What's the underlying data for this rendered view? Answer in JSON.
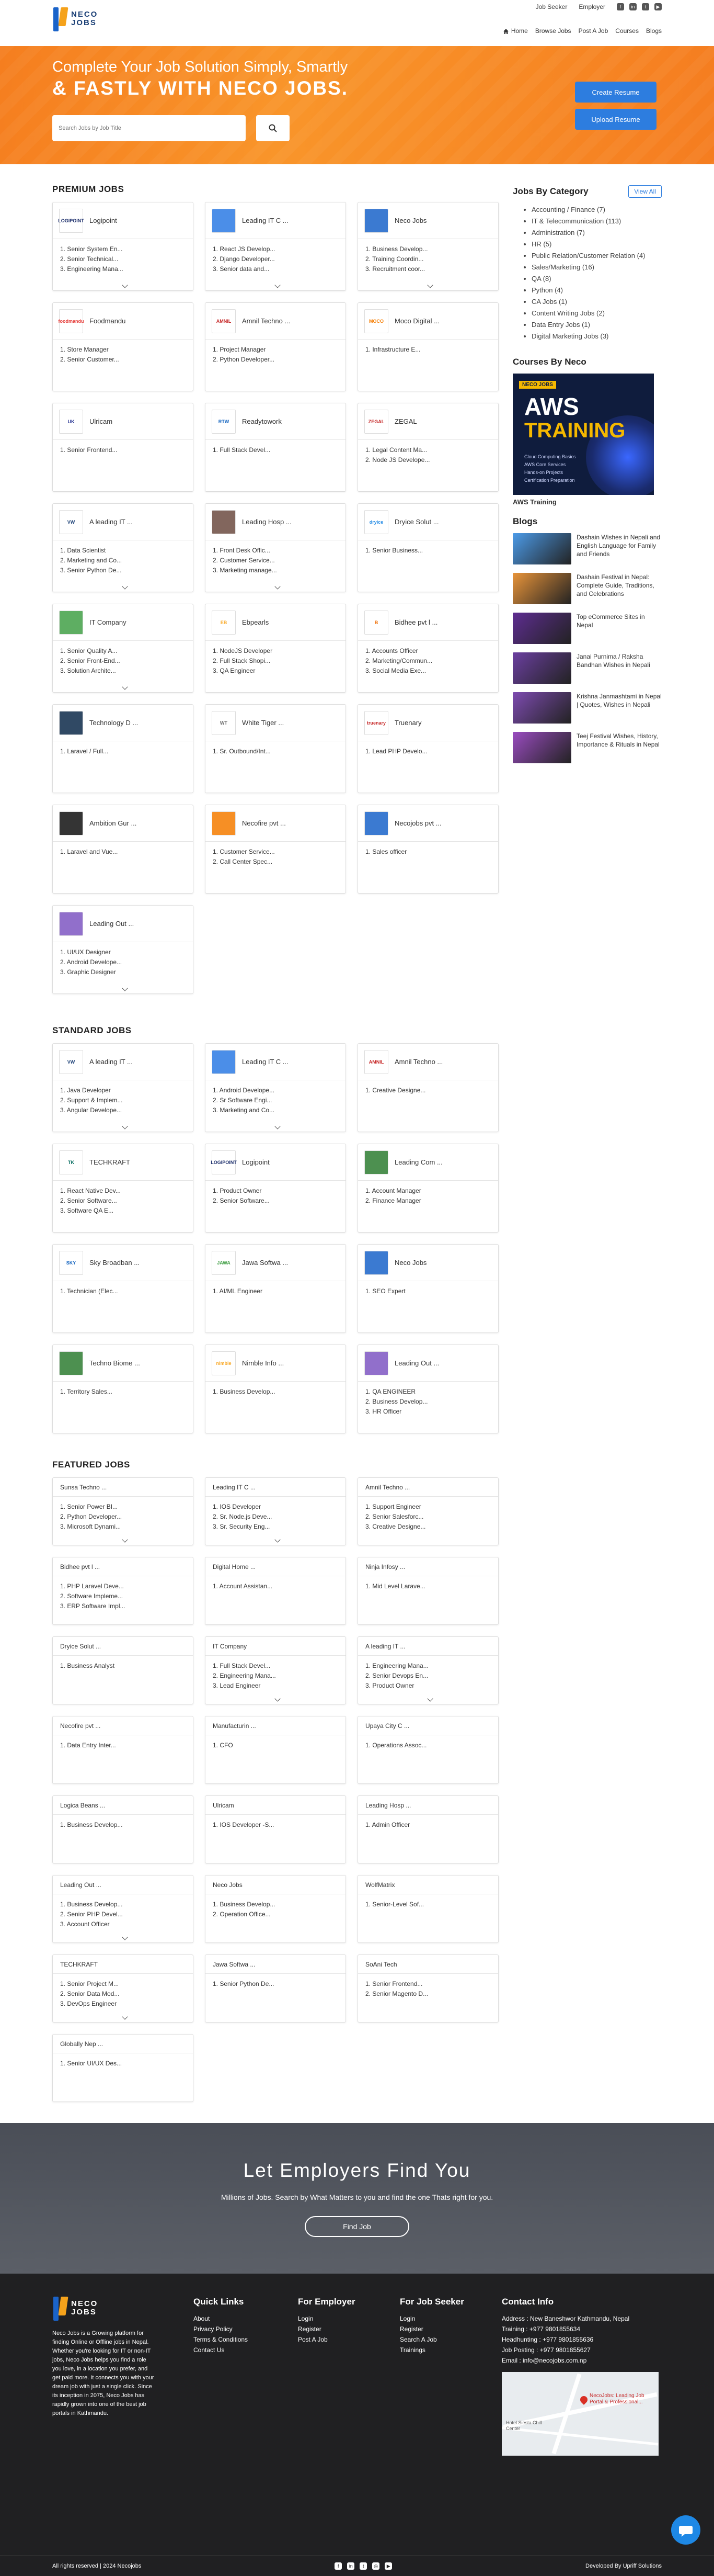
{
  "brand": {
    "logo_line1": "NECO",
    "logo_line2": "JOBS"
  },
  "topbar": {
    "job_seeker": "Job Seeker",
    "employer": "Employer"
  },
  "nav": [
    "Home",
    "Browse Jobs",
    "Post A Job",
    "Courses",
    "Blogs"
  ],
  "hero": {
    "line1": "Complete Your Job Solution Simply, Smartly",
    "line2": "& FASTLY WITH NECO JOBS.",
    "search_placeholder": "Search Jobs by Job Title",
    "create_resume": "Create Resume",
    "upload_resume": "Upload Resume"
  },
  "premium": {
    "title": "PREMIUM JOBS",
    "cards": [
      {
        "name": "Logipoint",
        "logo": "LOGIPOINT",
        "logo_color": "#1b2d6b",
        "jobs": [
          "1. Senior System En...",
          "2. Senior Technical...",
          "3. Engineering Mana..."
        ],
        "more": true
      },
      {
        "name": "Leading IT C ...",
        "logo": "",
        "logo_color": "#2c7be5",
        "jobs": [
          "1. React JS Develop...",
          "2. Django Developer...",
          "3. Senior data and..."
        ],
        "more": true
      },
      {
        "name": "Neco Jobs",
        "logo": "",
        "logo_color": "#1a63c9",
        "jobs": [
          "1. Business Develop...",
          "2. Training Coordin...",
          "3. Recruitment coor..."
        ],
        "more": true
      },
      {
        "name": "Foodmandu",
        "logo": "foodmandu",
        "logo_color": "#e53935",
        "jobs": [
          "1. Store Manager",
          "2. Senior Customer..."
        ],
        "more": false
      },
      {
        "name": "Amnil Techno ...",
        "logo": "AMNIL",
        "logo_color": "#c62828",
        "jobs": [
          "1. Project Manager",
          "2. Python Developer..."
        ],
        "more": false
      },
      {
        "name": "Moco Digital ...",
        "logo": "MOCO",
        "logo_color": "#f57c00",
        "jobs": [
          "1. Infrastructure E..."
        ],
        "more": false
      },
      {
        "name": "Ulricam",
        "logo": "UK",
        "logo_color": "#283593",
        "jobs": [
          "1. Senior Frontend..."
        ],
        "more": false
      },
      {
        "name": "Readytowork",
        "logo": "RTW",
        "logo_color": "#1565c0",
        "jobs": [
          "1. Full Stack Devel..."
        ],
        "more": false
      },
      {
        "name": "ZEGAL",
        "logo": "ZEGAL",
        "logo_color": "#c62828",
        "jobs": [
          "1. Legal Content Ma...",
          "2. Node JS Develope..."
        ],
        "more": false
      },
      {
        "name": "A leading IT ...",
        "logo": "VW",
        "logo_color": "#1a3f75",
        "jobs": [
          "1. Data Scientist",
          "2. Marketing and Co...",
          "3. Senior Python De..."
        ],
        "more": true
      },
      {
        "name": "Leading Hosp ...",
        "logo": "",
        "logo_color": "#6d4c41",
        "jobs": [
          "1. Front Desk Offic...",
          "2. Customer Service...",
          "3. Marketing manage..."
        ],
        "more": true
      },
      {
        "name": "Dryice Solut ...",
        "logo": "dryice",
        "logo_color": "#1e88e5",
        "jobs": [
          "1. Senior Business..."
        ],
        "more": false
      },
      {
        "name": "IT Company",
        "logo": "",
        "logo_color": "#43a047",
        "jobs": [
          "1. Senior Quality A...",
          "2. Senior Front-End...",
          "3. Solution Archite..."
        ],
        "more": true
      },
      {
        "name": "Ebpearls",
        "logo": "EB",
        "logo_color": "#f9a825",
        "jobs": [
          "1. NodeJS Developer",
          "2. Full Stack Shopi...",
          "3. QA Engineer"
        ],
        "more": false
      },
      {
        "name": "Bidhee pvt l ...",
        "logo": "B",
        "logo_color": "#ef6c00",
        "jobs": [
          "1. Accounts Officer",
          "2. Marketing/Commun...",
          "3. Social Media Exe..."
        ],
        "more": false
      },
      {
        "name": "Technology D ...",
        "logo": "",
        "logo_color": "#0d2a4a",
        "jobs": [
          "1. Laravel / Full..."
        ],
        "more": false
      },
      {
        "name": "White Tiger ...",
        "logo": "WT",
        "logo_color": "#555555",
        "jobs": [
          "1. Sr. Outbound/Int..."
        ],
        "more": false
      },
      {
        "name": "Truenary",
        "logo": "truenary",
        "logo_color": "#c62828",
        "jobs": [
          "1. Lead PHP Develo..."
        ],
        "more": false
      },
      {
        "name": "Ambition Gur ...",
        "logo": "",
        "logo_color": "#111111",
        "jobs": [
          "1. Laravel and Vue..."
        ],
        "more": false
      },
      {
        "name": "Necofire pvt ...",
        "logo": "",
        "logo_color": "#f57c00",
        "jobs": [
          "1. Customer Service...",
          "2. Call Center Spec..."
        ],
        "more": false
      },
      {
        "name": "Necojobs pvt ...",
        "logo": "",
        "logo_color": "#1a63c9",
        "jobs": [
          "1. Sales officer"
        ],
        "more": false
      },
      {
        "name": "Leading Out ...",
        "logo": "",
        "logo_color": "#7e57c2",
        "jobs": [
          "1. UI/UX Designer",
          "2. Android Develope...",
          "3. Graphic Designer"
        ],
        "more": true
      }
    ]
  },
  "standard": {
    "title": "STANDARD JOBS",
    "cards": [
      {
        "name": "A leading IT ...",
        "logo": "VW",
        "logo_color": "#1a3f75",
        "jobs": [
          "1. Java Developer",
          "2. Support & Implem...",
          "3. Angular Develope..."
        ],
        "more": true
      },
      {
        "name": "Leading IT C ...",
        "logo": "",
        "logo_color": "#2c7be5",
        "jobs": [
          "1. Android Develope...",
          "2. Sr Software Engi...",
          "3. Marketing and Co..."
        ],
        "more": true
      },
      {
        "name": "Amnil Techno ...",
        "logo": "AMNIL",
        "logo_color": "#c62828",
        "jobs": [
          "1. Creative Designe..."
        ],
        "more": false
      },
      {
        "name": "TECHKRAFT",
        "logo": "TK",
        "logo_color": "#00695c",
        "jobs": [
          "1. React Native Dev...",
          "2. Senior Software...",
          "3. Software QA E..."
        ],
        "more": false
      },
      {
        "name": "Logipoint",
        "logo": "LOGIPOINT",
        "logo_color": "#1b2d6b",
        "jobs": [
          "1. Product Owner",
          "2. Senior Software..."
        ],
        "more": false
      },
      {
        "name": "Leading Com ...",
        "logo": "",
        "logo_color": "#2e7d32",
        "jobs": [
          "1. Account Manager",
          "2. Finance Manager"
        ],
        "more": false
      },
      {
        "name": "Sky Broadban ...",
        "logo": "SKY",
        "logo_color": "#1565c0",
        "jobs": [
          "1. Technician (Elec..."
        ],
        "more": false
      },
      {
        "name": "Jawa Softwa ...",
        "logo": "JAWA",
        "logo_color": "#43a047",
        "jobs": [
          "1. AI/ML Engineer"
        ],
        "more": false
      },
      {
        "name": "Neco Jobs",
        "logo": "",
        "logo_color": "#1a63c9",
        "jobs": [
          "1. SEO Expert"
        ],
        "more": false
      },
      {
        "name": "Techno Biome ...",
        "logo": "",
        "logo_color": "#2e7d32",
        "jobs": [
          "1. Territory Sales..."
        ],
        "more": false
      },
      {
        "name": "Nimble Info ...",
        "logo": "nimble",
        "logo_color": "#f9a825",
        "jobs": [
          "1. Business Develop..."
        ],
        "more": false
      },
      {
        "name": "Leading Out ...",
        "logo": "",
        "logo_color": "#7e57c2",
        "jobs": [
          "1. QA ENGINEER",
          "2. Business Develop...",
          "3. HR Officer"
        ],
        "more": false
      }
    ]
  },
  "featured": {
    "title": "FEATURED JOBS",
    "cards": [
      {
        "name": "Sunsa Techno ...",
        "jobs": [
          "1. Senior Power BI...",
          "2. Python Developer...",
          "3. Microsoft Dynami..."
        ],
        "more": true
      },
      {
        "name": "Leading IT C ...",
        "jobs": [
          "1. IOS Developer",
          "2. Sr. Node.js Deve...",
          "3. Sr. Security Eng..."
        ],
        "more": true
      },
      {
        "name": "Amnil Techno ...",
        "jobs": [
          "1. Support Engineer",
          "2. Senior Salesforc...",
          "3. Creative Designe..."
        ],
        "more": false
      },
      {
        "name": "Bidhee pvt l ...",
        "jobs": [
          "1. PHP Laravel Deve...",
          "2. Software Impleme...",
          "3. ERP Software Impl..."
        ],
        "more": false
      },
      {
        "name": "Digital Home ...",
        "jobs": [
          "1. Account Assistan..."
        ],
        "more": false
      },
      {
        "name": "Ninja Infosy ...",
        "jobs": [
          "1. Mid Level Larave..."
        ],
        "more": false
      },
      {
        "name": "Dryice Solut ...",
        "jobs": [
          "1. Business Analyst"
        ],
        "more": false
      },
      {
        "name": "IT Company",
        "jobs": [
          "1. Full Stack Devel...",
          "2. Engineering Mana...",
          "3. Lead Engineer"
        ],
        "more": true
      },
      {
        "name": "A leading IT ...",
        "jobs": [
          "1. Engineering Mana...",
          "2. Senior Devops En...",
          "3. Product Owner"
        ],
        "more": true
      },
      {
        "name": "Necofire pvt ...",
        "jobs": [
          "1. Data Entry Inter..."
        ],
        "more": false
      },
      {
        "name": "Manufacturin ...",
        "jobs": [
          "1. CFO"
        ],
        "more": false
      },
      {
        "name": "Upaya City C ...",
        "jobs": [
          "1. Operations Assoc..."
        ],
        "more": false
      },
      {
        "name": "Logica Beans ...",
        "jobs": [
          "1. Business Develop..."
        ],
        "more": false
      },
      {
        "name": "Ulricam",
        "jobs": [
          "1. IOS Developer -S..."
        ],
        "more": false
      },
      {
        "name": "Leading Hosp ...",
        "jobs": [
          "1. Admin Officer"
        ],
        "more": false
      },
      {
        "name": "Leading Out ...",
        "jobs": [
          "1. Business Develop...",
          "2. Senior PHP Devel...",
          "3. Account Officer"
        ],
        "more": true
      },
      {
        "name": "Neco Jobs",
        "jobs": [
          "1. Business Develop...",
          "2. Operation Office..."
        ],
        "more": false
      },
      {
        "name": "WolfMatrix",
        "jobs": [
          "1. Senior-Level Sof..."
        ],
        "more": false
      },
      {
        "name": "TECHKRAFT",
        "jobs": [
          "1. Senior Project M...",
          "2. Senior Data Mod...",
          "3. DevOps Engineer"
        ],
        "more": true
      },
      {
        "name": "Jawa Softwa ...",
        "jobs": [
          "1. Senior Python De..."
        ],
        "more": false
      },
      {
        "name": "SoAni Tech",
        "jobs": [
          "1. Senior Frontend...",
          "2. Senior Magento D..."
        ],
        "more": false
      },
      {
        "name": "Globally Nep ...",
        "jobs": [
          "1. Senior UI/UX Des..."
        ],
        "more": false
      }
    ]
  },
  "sidebar": {
    "cat_title": "Jobs By Category",
    "view_all": "View All",
    "categories": [
      "Accounting / Finance (7)",
      "IT & Telecommunication (113)",
      "Administration (7)",
      "HR (5)",
      "Public Relation/Customer Relation (4)",
      "Sales/Marketing (16)",
      "QA (8)",
      "Python (4)",
      "CA Jobs (1)",
      "Content Writing Jobs (2)",
      "Data Entry Jobs (1)",
      "Digital Marketing Jobs (3)"
    ],
    "courses_title": "Courses By Neco",
    "course_badge": "NECO JOBS",
    "course_img_line1": "AWS",
    "course_img_line2": "TRAINING",
    "course_points": [
      "Cloud Computing Basics",
      "AWS Core Services",
      "Hands-on Projects",
      "Certification Preparation"
    ],
    "course_name": "AWS Training",
    "blogs_title": "Blogs",
    "blogs": [
      {
        "title": "Dashain Wishes in Nepali and English Language for Family and Friends",
        "color": "#4c9be8"
      },
      {
        "title": "Dashain Festival in Nepal: Complete Guide, Traditions, and Celebrations",
        "color": "#e8943a"
      },
      {
        "title": "Top eCommerce Sites in Nepal",
        "color": "#5e2d91"
      },
      {
        "title": "Janai Purnima / Raksha Bandhan Wishes in Nepali",
        "color": "#6b3fa0"
      },
      {
        "title": "Krishna Janmashtami in Nepal | Quotes, Wishes in Nepali",
        "color": "#7d4bb0"
      },
      {
        "title": "Teej Festival Wishes, History, Importance & Rituals in Nepal",
        "color": "#9a4cc0"
      }
    ]
  },
  "banner": {
    "title": "Let Employers Find You",
    "subtitle": "Millions of Jobs. Search by What Matters to you and find the one Thats right for you.",
    "button": "Find Job"
  },
  "footer": {
    "about": "Neco Jobs is a Growing platform for finding Online or Offline jobs in Nepal. Whether you're looking for IT or non-IT jobs, Neco Jobs helps you find a role you love, in a location you prefer, and get paid more. It connects you with your dream job with just a single click. Since its inception in 2075, Neco Jobs has rapidly grown into one of the best job portals in Kathmandu.",
    "quick_title": "Quick Links",
    "quick_links": [
      "About",
      "Privacy Policy",
      "Terms & Conditions",
      "Contact Us"
    ],
    "employer_title": "For Employer",
    "employer_links": [
      "Login",
      "Register",
      "Post A Job"
    ],
    "seeker_title": "For Job Seeker",
    "seeker_links": [
      "Login",
      "Register",
      "Search A Job",
      "Trainings"
    ],
    "contact_title": "Contact Info",
    "contact_lines": [
      "Address : New Baneshwor Kathmandu, Nepal",
      "Training : +977 9801855634",
      "Headhunting : +977 9801855636",
      "Job Posting : +977 9801855627",
      "Email : info@necojobs.com.np"
    ],
    "map_label": "NecoJobs: Leading Job Portal & Professional...",
    "map_place": "Hotel Siesta Chill Center",
    "copyright": "All rights reserved | 2024 Necojobs",
    "developed": "Developed By Upriff Solutions"
  }
}
